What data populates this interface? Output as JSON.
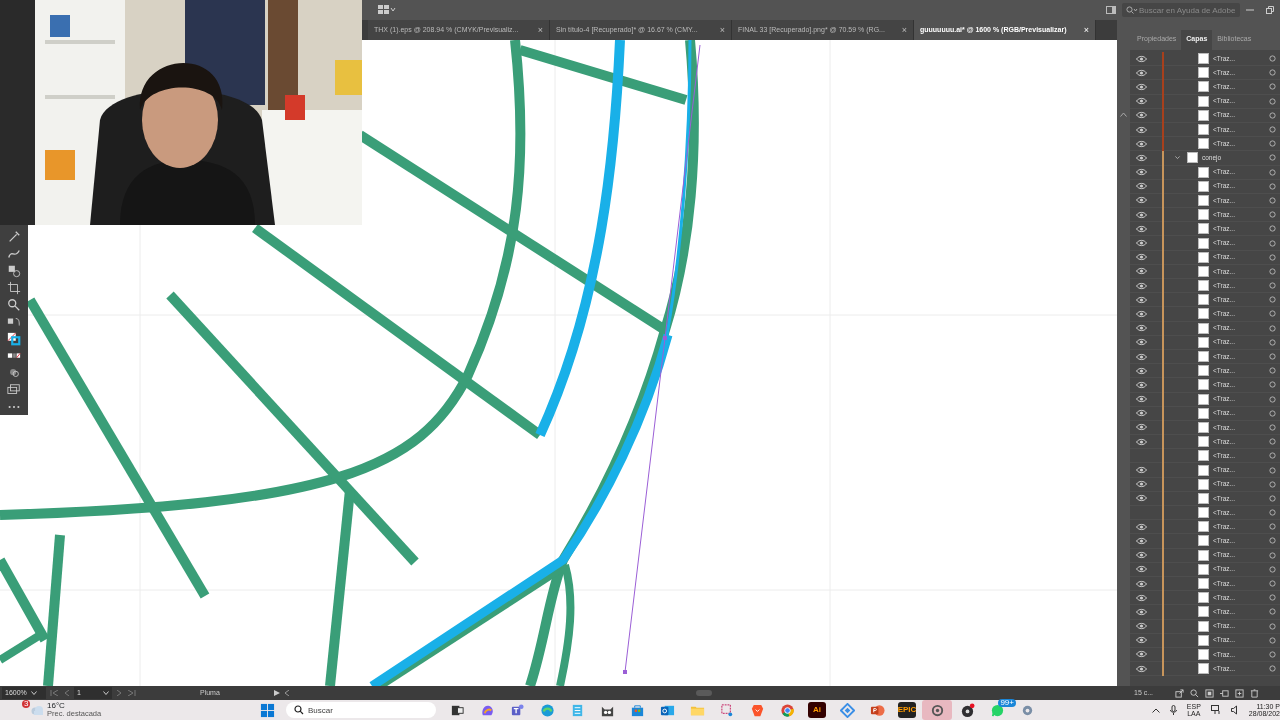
{
  "top_bar": {
    "search": {
      "placeholder": "Buscar en Ayuda de Adobe"
    }
  },
  "tabs": [
    {
      "label": "THX (1).eps @ 208.94 % (CMYK/Previsualiz...",
      "close": "×",
      "selected": false
    },
    {
      "label": "Sin título-4 [Recuperado]* @ 16.67 % (CMY...",
      "close": "×",
      "selected": false
    },
    {
      "label": "FINAL 33 [Recuperado].png* @ 70.59 % (RG...",
      "close": "×",
      "selected": false
    },
    {
      "label": "guuuuuuu.ai* @ 1600 % (RGB/Previsualizar)",
      "close": "×",
      "selected": true
    }
  ],
  "panel": {
    "tabs": [
      {
        "label": "Propiedades",
        "selected": false
      },
      {
        "label": "Capas",
        "selected": true
      },
      {
        "label": "Bibliotecas",
        "selected": false
      }
    ],
    "layers": [
      {
        "name": "<Traz...",
        "visible": true,
        "color": "#a8401c"
      },
      {
        "name": "<Traz...",
        "visible": true,
        "color": "#a8401c"
      },
      {
        "name": "<Traz...",
        "visible": true,
        "color": "#a8401c"
      },
      {
        "name": "<Traz...",
        "visible": true,
        "color": "#a8401c"
      },
      {
        "name": "<Traz...",
        "visible": true,
        "color": "#a8401c"
      },
      {
        "name": "<Traz...",
        "visible": true,
        "color": "#a8401c"
      },
      {
        "name": "<Traz...",
        "visible": true,
        "color": "#a8401c"
      },
      {
        "name": "conejo",
        "visible": true,
        "expanded": true,
        "color": "#c8955b",
        "children": [
          {
            "name": "<Traz...",
            "visible": true
          },
          {
            "name": "<Traz...",
            "visible": true
          },
          {
            "name": "<Traz...",
            "visible": true
          },
          {
            "name": "<Traz...",
            "visible": true
          },
          {
            "name": "<Traz...",
            "visible": true
          },
          {
            "name": "<Traz...",
            "visible": true
          },
          {
            "name": "<Traz...",
            "visible": true
          },
          {
            "name": "<Traz...",
            "visible": true
          },
          {
            "name": "<Traz...",
            "visible": true
          },
          {
            "name": "<Traz...",
            "visible": true
          },
          {
            "name": "<Traz...",
            "visible": true
          },
          {
            "name": "<Traz...",
            "visible": true
          },
          {
            "name": "<Traz...",
            "visible": true
          },
          {
            "name": "<Traz...",
            "visible": true
          },
          {
            "name": "<Traz...",
            "visible": true
          },
          {
            "name": "<Traz...",
            "visible": true
          },
          {
            "name": "<Traz...",
            "visible": true
          },
          {
            "name": "<Traz...",
            "visible": true
          },
          {
            "name": "<Traz...",
            "visible": true
          },
          {
            "name": "<Traz...",
            "visible": true
          },
          {
            "name": "<Traz...",
            "visible": false
          },
          {
            "name": "<Traz...",
            "visible": true
          },
          {
            "name": "<Traz...",
            "visible": true
          },
          {
            "name": "<Traz...",
            "visible": true
          },
          {
            "name": "<Traz...",
            "visible": false
          },
          {
            "name": "<Traz...",
            "visible": true
          },
          {
            "name": "<Traz...",
            "visible": true
          },
          {
            "name": "<Traz...",
            "visible": true
          },
          {
            "name": "<Traz...",
            "visible": true
          },
          {
            "name": "<Traz...",
            "visible": true
          },
          {
            "name": "<Traz...",
            "visible": true
          },
          {
            "name": "<Traz...",
            "visible": true
          },
          {
            "name": "<Traz...",
            "visible": true
          },
          {
            "name": "<Traz...",
            "visible": true
          },
          {
            "name": "<Traz...",
            "visible": true
          },
          {
            "name": "<Traz...",
            "visible": true
          }
        ]
      }
    ],
    "footer": {
      "count": "15 c..."
    }
  },
  "status_bar": {
    "zoom": "1600%",
    "artboard": "1",
    "tool": "Pluma"
  },
  "taskbar": {
    "weather": {
      "temperature": "16°C",
      "badge": "3",
      "condition": "Prec. destacada"
    },
    "search": {
      "placeholder": "Buscar"
    },
    "apps": [
      {
        "kind": "start",
        "selected": false
      },
      {
        "kind": "search"
      },
      {
        "kind": "taskview",
        "selected": false
      },
      {
        "kind": "copilot",
        "selected": false
      },
      {
        "kind": "teams",
        "selected": false
      },
      {
        "kind": "edge",
        "selected": false
      },
      {
        "kind": "notepad",
        "selected": false
      },
      {
        "kind": "cat",
        "selected": false
      },
      {
        "kind": "store",
        "selected": false
      },
      {
        "kind": "outlook",
        "selected": false
      },
      {
        "kind": "folder",
        "selected": false
      },
      {
        "kind": "snip",
        "selected": false
      },
      {
        "kind": "brave",
        "selected": false
      },
      {
        "kind": "chrome",
        "selected": false
      },
      {
        "kind": "label",
        "label": "Ai",
        "color": "#330000",
        "selected": false
      },
      {
        "kind": "diamond",
        "selected": false
      },
      {
        "kind": "powerpoint",
        "selected": false
      },
      {
        "kind": "label",
        "label": "EPIC",
        "color": "#222222",
        "selected": false
      },
      {
        "kind": "steam",
        "selected": true
      },
      {
        "kind": "obs",
        "selected": false
      },
      {
        "kind": "whatsapp",
        "badge": "99+",
        "selected": false
      },
      {
        "kind": "gear",
        "selected": false
      }
    ],
    "tray": {
      "language": "ESP",
      "layout": "LAA",
      "time": "11:30 P",
      "date": "28/08/202"
    }
  }
}
